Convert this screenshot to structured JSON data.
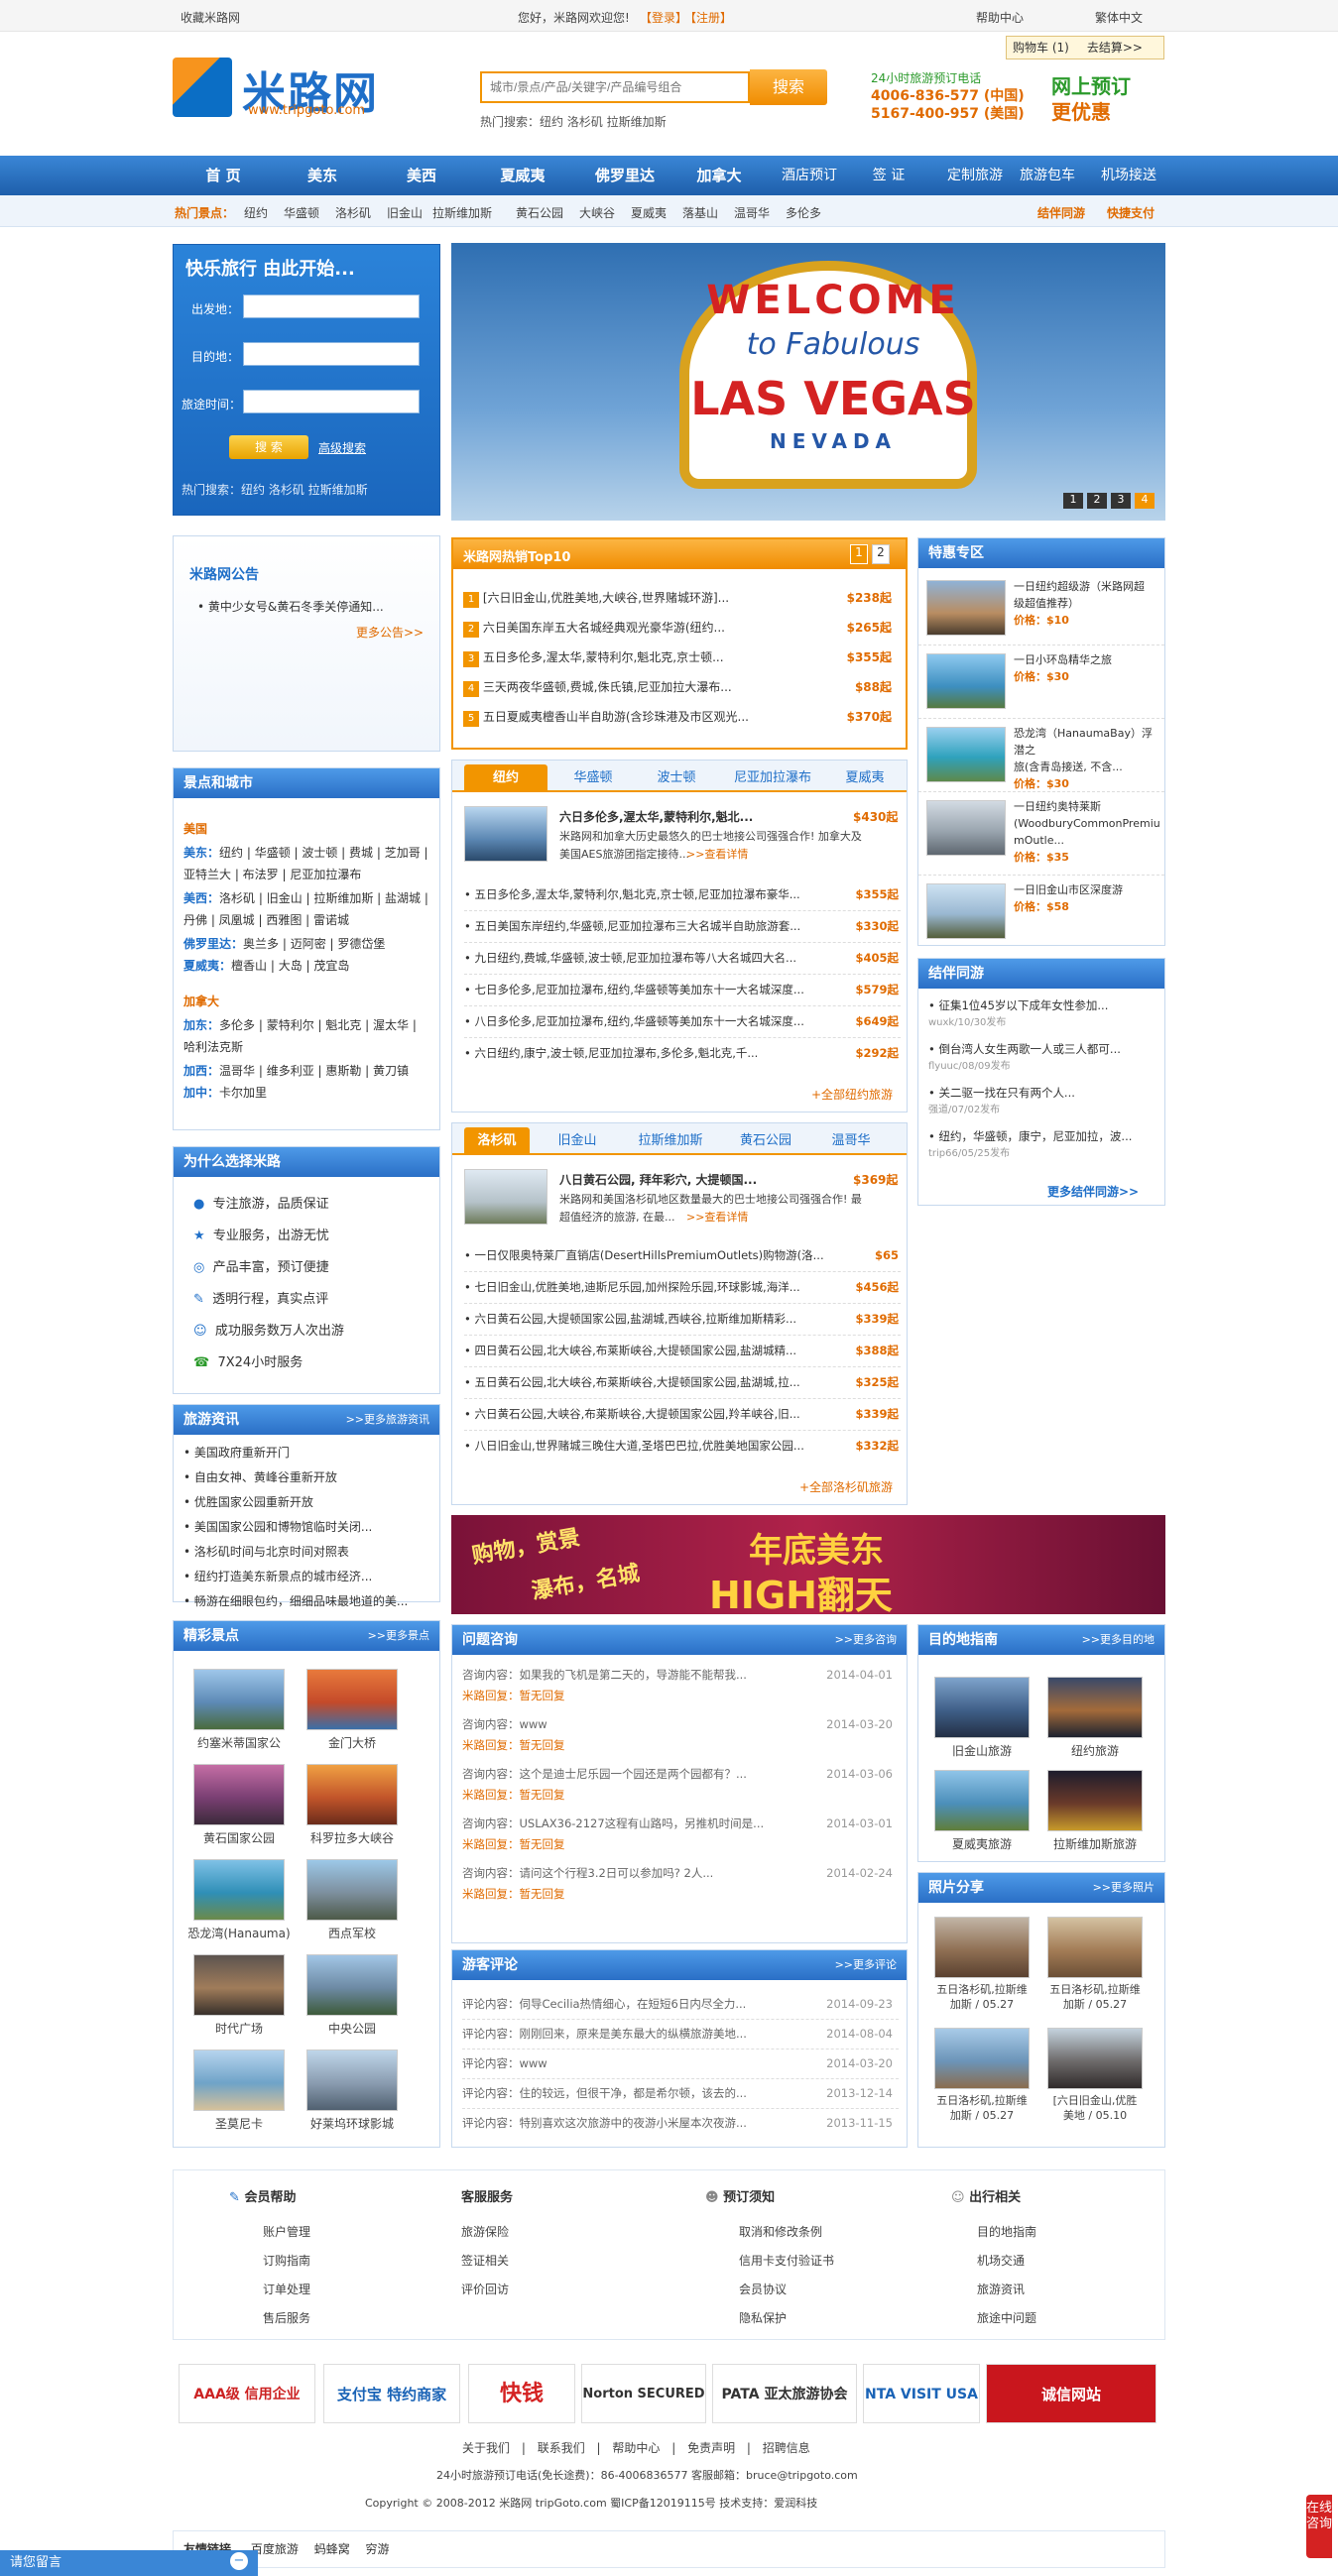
{
  "topbar": {
    "favorite": "收藏米路网",
    "welcome": "您好，米路网欢迎您!",
    "login": "【登录】",
    "register": "【注册】",
    "help": "帮助中心",
    "lang": "繁体中文"
  },
  "header": {
    "logo_cn": "米路网",
    "logo_url": "www.tripgoto.com",
    "search_placeholder": "城市/景点/产品/关键字/产品编号组合",
    "search_btn": "搜索",
    "hot_search": "热门搜索：纽约 洛杉矶 拉斯维加斯",
    "hotline_title": "24小时旅游预订电话",
    "phone_cn": "4006-836-577 (中国)",
    "phone_us": "5167-400-957 (美国)",
    "order_line1": "网上预订",
    "order_line2": "更优惠",
    "cart_label": "购物车 (1)",
    "checkout": "去结算>>"
  },
  "nav": {
    "items": [
      "首 页",
      "美东",
      "美西",
      "夏威夷",
      "佛罗里达",
      "加拿大",
      "酒店预订",
      "签 证",
      "定制旅游",
      "旅游包车",
      "机场接送"
    ]
  },
  "subnav": {
    "label": "热门景点：",
    "items": [
      "纽约",
      "华盛顿",
      "洛杉矶",
      "旧金山",
      "拉斯维加斯",
      "黄石公园",
      "大峡谷",
      "夏威夷",
      "落基山",
      "温哥华",
      "多伦多"
    ],
    "right1": "结伴同游",
    "right2": "快捷支付"
  },
  "searchbox": {
    "title": "快乐旅行  由此开始...",
    "from": "出发地：",
    "to": "目的地：",
    "date": "旅途时间：",
    "btn": "搜 索",
    "adv": "高级搜索",
    "hot": "热门搜索：纽约 洛杉矶 拉斯维加斯"
  },
  "banner": {
    "welcome": "WELCOME",
    "fabulous": "to Fabulous",
    "vegas": "LAS VEGAS",
    "nevada": "NEVADA",
    "pages": [
      "1",
      "2",
      "3",
      "4"
    ]
  },
  "notice": {
    "title": "米路网公告",
    "item": "• 黄中少女号&黄石冬季关停通知...",
    "more": "更多公告>>"
  },
  "top10": {
    "title": "米路网热销Top10",
    "pages": [
      "1",
      "2"
    ],
    "items": [
      {
        "no": "1",
        "text": "[六日旧金山,优胜美地,大峡谷,世界赌城环游]...",
        "price": "$238起"
      },
      {
        "no": "2",
        "text": "六日美国东岸五大名城经典观光豪华游(纽约...",
        "price": "$265起"
      },
      {
        "no": "3",
        "text": "五日多伦多,渥太华,蒙特利尔,魁北克,京士顿...",
        "price": "$355起"
      },
      {
        "no": "4",
        "text": "三天两夜华盛顿,费城,侏氏镇,尼亚加拉大瀑布...",
        "price": "$88起"
      },
      {
        "no": "5",
        "text": "五日夏威夷檀香山半自助游(含珍珠港及市区观光...",
        "price": "$370起"
      }
    ]
  },
  "special": {
    "title": "特惠专区",
    "items": [
      {
        "t1": "一日纽约超级游（米路网超",
        "t2": "级超值推荐）",
        "price": "价格：$10"
      },
      {
        "t1": "一日小环岛精华之旅",
        "t2": "",
        "price": "价格：$30"
      },
      {
        "t1": "恐龙湾（HanaumaBay）浮潜之",
        "t2": "旅(含青岛接送, 不含...",
        "price": "价格：$30"
      },
      {
        "t1": "一日纽约奥特莱斯",
        "t2": "(WoodburyCommonPremiumOutle...",
        "price": "价格：$35"
      },
      {
        "t1": "一日旧金山市区深度游",
        "t2": "",
        "price": "价格：$58"
      }
    ]
  },
  "partner": {
    "title": "结伴同游",
    "items": [
      {
        "t": "• 征集1位45岁以下成年女性参加...",
        "m": "wuxk/10/30发布"
      },
      {
        "t": "• 倒台湾人女生两歌一人或三人都可...",
        "m": "flyuuc/08/09发布"
      },
      {
        "t": "• 关二驱一找在只有两个人...",
        "m": "强道/07/02发布"
      },
      {
        "t": "• 纽约，华盛顿，康宁，尼亚加拉，波...",
        "m": "trip66/05/25发布"
      }
    ],
    "more": "更多结伴同游>>"
  },
  "scenic": {
    "title": "景点和城市",
    "us": "美国",
    "us_rows": [
      {
        "k": "美东：",
        "v": "纽约 | 华盛顿 | 波士顿 | 费城 | 芝加哥 | 亚特兰大 | 布法罗 | 尼亚加拉瀑布"
      },
      {
        "k": "美西：",
        "v": "洛杉矶 | 旧金山 | 拉斯维加斯 | 盐湖城 | 丹佛 | 凤凰城 | 西雅图 | 雷诺城"
      },
      {
        "k": "佛罗里达：",
        "v": "奥兰多 | 迈阿密 | 罗德岱堡"
      },
      {
        "k": "夏威夷：",
        "v": "檀香山 | 大岛 | 茂宜岛"
      }
    ],
    "ca": "加拿大",
    "ca_rows": [
      {
        "k": "加东：",
        "v": "多伦多 | 蒙特利尔 | 魁北克 | 渥太华 | 哈利法克斯"
      },
      {
        "k": "加西：",
        "v": "温哥华 | 维多利亚 | 惠斯勒 | 黄刀镇"
      },
      {
        "k": "加中：",
        "v": "卡尔加里"
      }
    ]
  },
  "why": {
    "title": "为什么选择米路",
    "items": [
      "专注旅游，品质保证",
      "专业服务，出游无忧",
      "产品丰富，预订便捷",
      "透明行程，真实点评",
      "成功服务数万人次出游",
      "7X24小时服务"
    ]
  },
  "news": {
    "title": "旅游资讯",
    "more": ">>更多旅游资讯",
    "items": [
      "• 美国政府重新开门",
      "• 自由女神、黄峰谷重新开放",
      "• 优胜国家公园重新开放",
      "• 美国国家公园和博物馆临时关闭...",
      "• 洛杉矶时间与北京时间对照表",
      "• 纽约打造美东新景点的城市经济...",
      "• 畅游在细眼包约，细细品味最地道的美..."
    ]
  },
  "tabs1": {
    "tabs": [
      "纽约",
      "华盛顿",
      "波士顿",
      "尼亚加拉瀑布",
      "夏威夷"
    ],
    "feature_title": "六日多伦多,渥太华,蒙特利尔,魁北...",
    "feature_price": "$430起",
    "feature_desc1": "米路网和加拿大历史最悠久的巴士地接公司强强合作! 加拿大及",
    "feature_desc2": "美国AES旅游团指定接待...",
    "feature_more": ">>查看详情",
    "items": [
      {
        "t": "• 五日多伦多,渥太华,蒙特利尔,魁北克,京士顿,尼亚加拉瀑布豪华...",
        "p": "$355起"
      },
      {
        "t": "• 五日美国东岸纽约,华盛顿,尼亚加拉瀑布三大名城半自助旅游套...",
        "p": "$330起"
      },
      {
        "t": "• 九日纽约,费城,华盛顿,波士顿,尼亚加拉瀑布等八大名城四大名...",
        "p": "$405起"
      },
      {
        "t": "• 七日多伦多,尼亚加拉瀑布,纽约,华盛顿等美加东十一大名城深度...",
        "p": "$579起"
      },
      {
        "t": "• 八日多伦多,尼亚加拉瀑布,纽约,华盛顿等美加东十一大名城深度...",
        "p": "$649起"
      },
      {
        "t": "• 六日纽约,康宁,波士顿,尼亚加拉瀑布,多伦多,魁北克,千...",
        "p": "$292起"
      }
    ],
    "all": "+全部纽约旅游"
  },
  "tabs2": {
    "tabs": [
      "洛杉矶",
      "旧金山",
      "拉斯维加斯",
      "黄石公园",
      "温哥华"
    ],
    "feature_title": "八日黄石公园, 拜年彩穴, 大提顿国...",
    "feature_price": "$369起",
    "feature_desc1": "米路网和美国洛杉矶地区数量最大的巴士地接公司强强合作! 最",
    "feature_desc2": "超值经济的旅游, 在最...",
    "feature_more": ">>查看详情",
    "items": [
      {
        "t": "• 一日仅限奥特莱厂直销店(DesertHillsPremiumOutlets)购物游(洛...",
        "p": "$65"
      },
      {
        "t": "• 七日旧金山,优胜美地,迪斯尼乐园,加州探险乐园,环球影城,海洋...",
        "p": "$456起"
      },
      {
        "t": "• 六日黄石公园,大提顿国家公园,盐湖城,西峡谷,拉斯维加斯精彩...",
        "p": "$339起"
      },
      {
        "t": "• 四日黄石公园,北大峡谷,布莱斯峡谷,大提顿国家公园,盐湖城精...",
        "p": "$388起"
      },
      {
        "t": "• 五日黄石公园,北大峡谷,布莱斯峡谷,大提顿国家公园,盐湖城,拉...",
        "p": "$325起"
      },
      {
        "t": "• 六日黄石公园,大峡谷,布莱斯峡谷,大提顿国家公园,羚羊峡谷,旧...",
        "p": "$339起"
      },
      {
        "t": "• 八日旧金山,世界赌城三晚住大道,圣塔巴巴拉,优胜美地国家公园...",
        "p": "$332起"
      }
    ],
    "all": "+全部洛杉矶旅游"
  },
  "ad": {
    "text1": "购物，赏景",
    "text2": "瀑布，名城",
    "text3": "年底美东",
    "text4": "HIGH翻天"
  },
  "spots": {
    "title": "精彩景点",
    "more": ">>更多景点",
    "items": [
      "约塞米蒂国家公",
      "金门大桥",
      "黄石国家公园",
      "科罗拉多大峡谷",
      "恐龙湾(Hanauma)",
      "西点军校",
      "时代广场",
      "中央公园",
      "圣莫尼卡",
      "好莱坞环球影城"
    ]
  },
  "qa": {
    "title": "问题咨询",
    "more": ">>更多咨询",
    "items": [
      {
        "q": "咨询内容：如果我的飞机是第二天的，导游能不能帮我...",
        "d": "2014-04-01",
        "a": "米路回复：暂无回复"
      },
      {
        "q": "咨询内容：www",
        "d": "2014-03-20",
        "a": "米路回复：暂无回复"
      },
      {
        "q": "咨询内容：这个是迪士尼乐园一个园还是两个园都有？...",
        "d": "2014-03-06",
        "a": "米路回复：暂无回复"
      },
      {
        "q": "咨询内容：USLAX36-2127这程有山路吗，另推机时间是...",
        "d": "2014-03-01",
        "a": "米路回复：暂无回复"
      },
      {
        "q": "咨询内容：请问这个行程3.2日可以参加吗? 2人...",
        "d": "2014-02-24",
        "a": "米路回复：暂无回复"
      }
    ]
  },
  "reviews": {
    "title": "游客评论",
    "more": ">>更多评论",
    "items": [
      {
        "t": "评论内容：伺导Cecilia热情细心，在短短6日内尽全力...",
        "d": "2014-09-23"
      },
      {
        "t": "评论内容：刚刚回来，原来是美东最大的纵横旅游美地...",
        "d": "2014-08-04"
      },
      {
        "t": "评论内容：www",
        "d": "2014-03-20"
      },
      {
        "t": "评论内容：住的较远，但很干净，都是希尔顿，该去的...",
        "d": "2013-12-14"
      },
      {
        "t": "评论内容：特别喜欢这次旅游中的夜游小米屋本次夜游...",
        "d": "2013-11-15"
      }
    ]
  },
  "guide": {
    "title": "目的地指南",
    "more": ">>更多目的地",
    "items": [
      "旧金山旅游",
      "纽约旅游",
      "夏威夷旅游",
      "拉斯维加斯旅游"
    ]
  },
  "photos": {
    "title": "照片分享",
    "more": ">>更多照片",
    "items": [
      {
        "l1": "五日洛杉矶,拉斯维",
        "l2": "加斯 / 05.27"
      },
      {
        "l1": "五日洛杉矶,拉斯维",
        "l2": "加斯 / 05.27"
      },
      {
        "l1": "五日洛杉矶,拉斯维",
        "l2": "加斯 / 05.27"
      },
      {
        "l1": "[六日旧金山,优胜",
        "l2": "美地 / 05.10"
      }
    ]
  },
  "footer": {
    "cols": [
      {
        "title": "会员帮助",
        "links": [
          "账户管理",
          "订购指南",
          "订单处理",
          "售后服务"
        ]
      },
      {
        "title": "客服服务",
        "links": [
          "旅游保险",
          "签证相关",
          "评价回访"
        ]
      },
      {
        "title": "预订须知",
        "links": [
          "取消和修改条例",
          "信用卡支付验证书",
          "会员协议",
          "隐私保护"
        ]
      },
      {
        "title": "出行相关",
        "links": [
          "目的地指南",
          "机场交通",
          "旅游资讯",
          "旅途中问题"
        ]
      }
    ],
    "badges": [
      "AAA级 信用企业",
      "支付宝 特约商家",
      "快钱",
      "Norton SECURED",
      "PATA 亚太旅游协会",
      "NTA VISIT USA",
      "诚信网站"
    ],
    "links": [
      "关于我们",
      "联系我们",
      "帮助中心",
      "免责声明",
      "招聘信息"
    ],
    "hotline": "24小时旅游预订电话(免长途费)：86-4006836577    客服邮箱：bruce@tripgoto.com",
    "copyright": "Copyright © 2008-2012  米路网    tripGoto.com  蜀ICP备12019115号    技术支持：爱润科技",
    "friend_label": "友情链接",
    "friend": [
      "百度旅游",
      "蚂蜂窝",
      "穷游"
    ],
    "consult": "请您留言",
    "side": "在线咨询"
  }
}
